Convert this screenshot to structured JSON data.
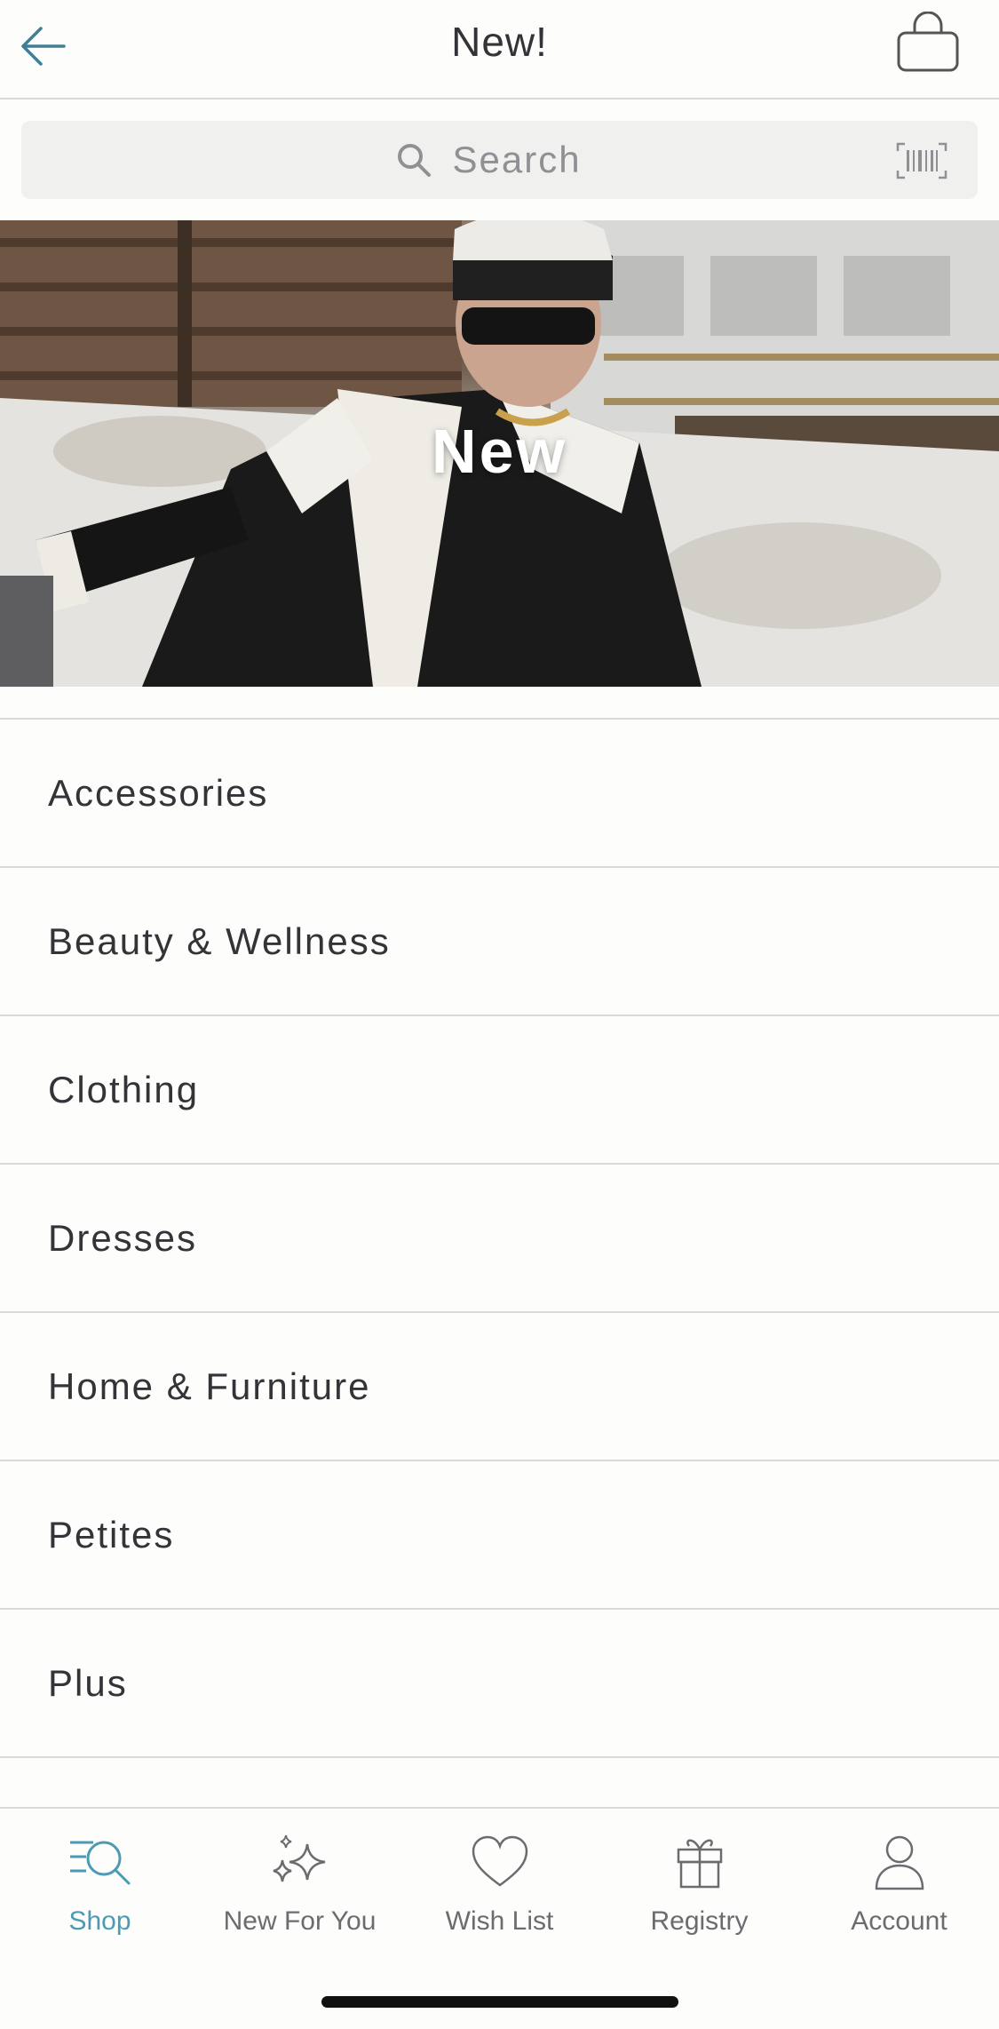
{
  "header": {
    "title": "New!",
    "back_icon": "arrow-left-icon",
    "bag_icon": "shopping-bag-icon"
  },
  "search": {
    "placeholder": "Search",
    "search_icon": "search-icon",
    "barcode_icon": "barcode-scan-icon"
  },
  "hero": {
    "title": "New"
  },
  "categories": [
    {
      "label": "Accessories"
    },
    {
      "label": "Beauty & Wellness"
    },
    {
      "label": "Clothing"
    },
    {
      "label": "Dresses"
    },
    {
      "label": "Home & Furniture"
    },
    {
      "label": "Petites"
    },
    {
      "label": "Plus"
    }
  ],
  "tabbar": {
    "tabs": [
      {
        "label": "Shop",
        "icon": "shop-search-icon",
        "active": true
      },
      {
        "label": "New For You",
        "icon": "sparkles-icon",
        "active": false
      },
      {
        "label": "Wish List",
        "icon": "heart-icon",
        "active": false
      },
      {
        "label": "Registry",
        "icon": "gift-icon",
        "active": false
      },
      {
        "label": "Account",
        "icon": "person-icon",
        "active": false
      }
    ]
  },
  "colors": {
    "accent": "#4b9bb5",
    "text": "#333438",
    "divider": "#d9d9d7",
    "background": "#fdfdfb"
  }
}
